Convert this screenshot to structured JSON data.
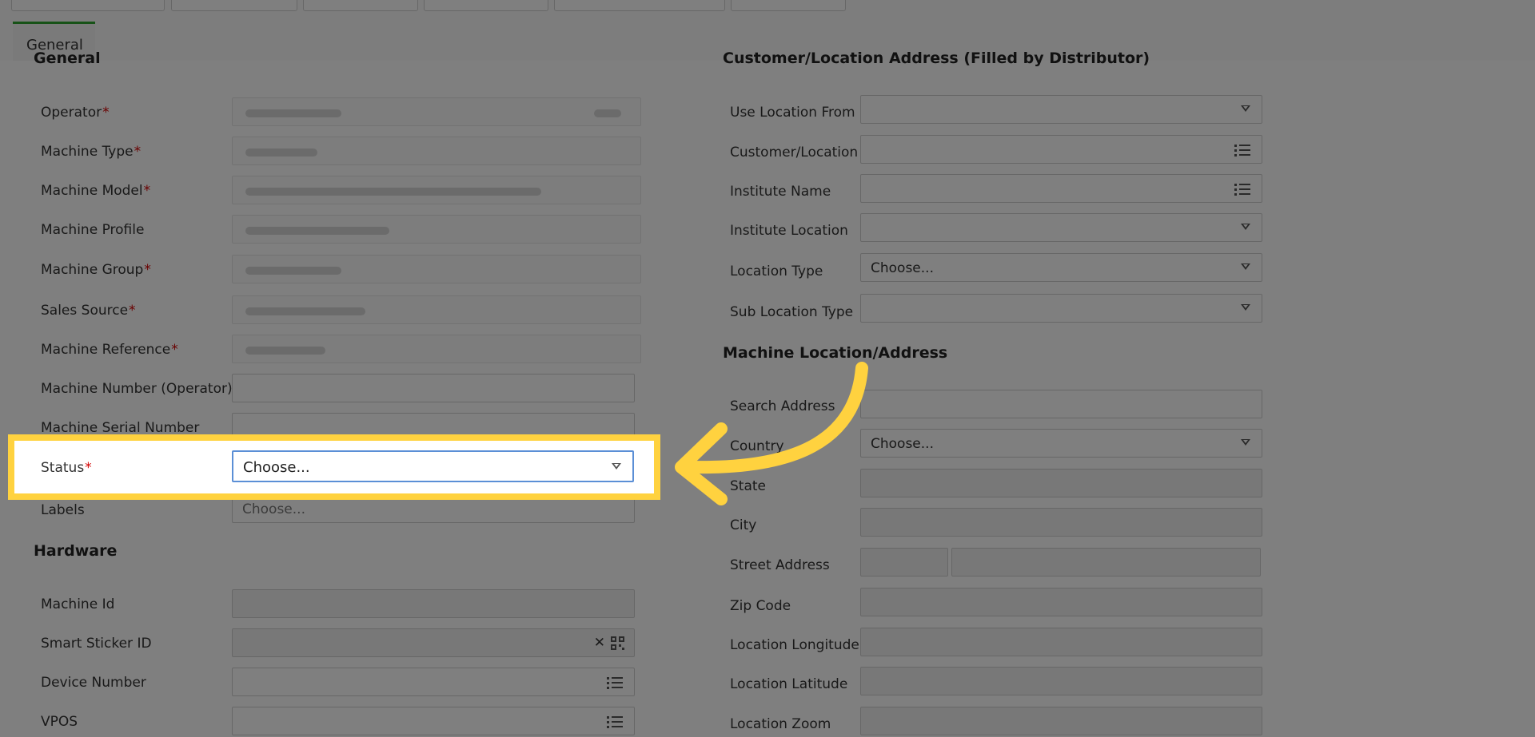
{
  "tabs": [
    {
      "label": "General"
    }
  ],
  "general": {
    "title": "General",
    "rows": [
      {
        "label": "Operator",
        "required": true
      },
      {
        "label": "Machine Type",
        "required": true
      },
      {
        "label": "Machine Model",
        "required": true
      },
      {
        "label": "Machine Profile",
        "required": false
      },
      {
        "label": "Machine Group",
        "required": true
      },
      {
        "label": "Sales Source",
        "required": true
      },
      {
        "label": "Machine Reference",
        "required": true
      },
      {
        "label": "Machine Number (Operator)",
        "required": false
      },
      {
        "label": "Machine Serial Number",
        "required": false
      }
    ],
    "status": {
      "label": "Status",
      "required_mark": "*",
      "value": "Choose..."
    },
    "labels": {
      "label": "Labels",
      "placeholder": "Choose..."
    }
  },
  "hardware": {
    "title": "Hardware",
    "rows": [
      {
        "label": "Machine Id"
      },
      {
        "label": "Smart Sticker ID"
      },
      {
        "label": "Device Number"
      },
      {
        "label": "VPOS"
      }
    ],
    "clear_glyph": "✕"
  },
  "customer_address": {
    "title": "Customer/Location Address (Filled by Distributor)",
    "rows": [
      {
        "label": "Use Location From",
        "control": "select",
        "value": ""
      },
      {
        "label": "Customer/Location",
        "control": "list",
        "value": ""
      },
      {
        "label": "Institute Name",
        "control": "list",
        "value": ""
      },
      {
        "label": "Institute Location",
        "control": "select",
        "value": ""
      },
      {
        "label": "Location Type",
        "control": "select",
        "value": "Choose..."
      },
      {
        "label": "Sub Location Type",
        "control": "select",
        "value": ""
      }
    ]
  },
  "machine_address": {
    "title": "Machine Location/Address",
    "rows": [
      {
        "label": "Search Address",
        "value": ""
      },
      {
        "label": "Country",
        "value": "Choose..."
      },
      {
        "label": "State",
        "value": ""
      },
      {
        "label": "City",
        "value": ""
      },
      {
        "label": "Street Address",
        "value": ""
      },
      {
        "label": "Zip Code",
        "value": ""
      },
      {
        "label": "Location Longitude",
        "value": ""
      },
      {
        "label": "Location Latitude",
        "value": ""
      },
      {
        "label": "Location Zoom",
        "value": ""
      }
    ]
  },
  "required_mark": "*",
  "colors": {
    "highlight": "#ffd23f",
    "tab_accent": "#2fa52f",
    "required": "#d40000"
  }
}
